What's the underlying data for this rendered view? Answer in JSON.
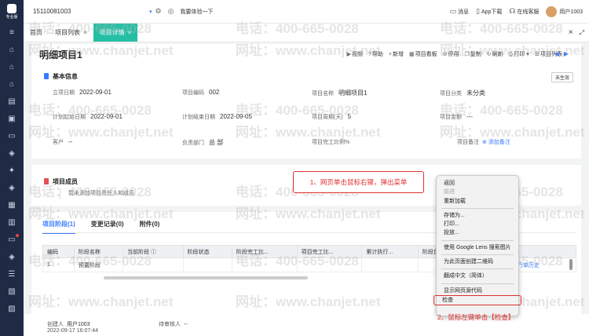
{
  "sidebar": {
    "brand_label": "专业版",
    "icons": [
      "menu-icon",
      "home-icon",
      "home-icon",
      "home-icon",
      "clipboard-icon",
      "gift-icon",
      "document-icon",
      "box-icon",
      "settings-icon",
      "box-icon",
      "briefcase-icon",
      "folder-icon",
      "document-icon",
      "box-icon",
      "list-icon",
      "inbox-icon",
      "layers-icon"
    ]
  },
  "topbar": {
    "company": "15110081003",
    "experience": "我要体验一下",
    "messages": "消息",
    "app_download": "App下载",
    "online_service": "在线客服",
    "user": "用户1003"
  },
  "tabs": [
    {
      "label": "首页",
      "closable": false,
      "active": false
    },
    {
      "label": "项目列表",
      "closable": true,
      "active": false
    },
    {
      "label": "项目详情",
      "closable": true,
      "active": true
    }
  ],
  "page": {
    "title": "明细项目1",
    "actions": [
      "视频",
      "帮助",
      "新增",
      "项目看板",
      "停用",
      "复制",
      "刷新",
      "打印",
      "项目列表"
    ],
    "status_badge": "未生效"
  },
  "basic_info": {
    "section_title": "基本信息",
    "fields": [
      {
        "label": "立项日期",
        "value": "2022-09-01"
      },
      {
        "label": "项目编码",
        "value": "002"
      },
      {
        "label": "项目名称",
        "value": "明细项目1"
      },
      {
        "label": "项目分类",
        "value": "未分类"
      },
      {
        "label": "计划起始日期",
        "value": "2022-09-01"
      },
      {
        "label": "计划结束日期",
        "value": "2022-09-05"
      },
      {
        "label": "项目周期(天)",
        "value": "5"
      },
      {
        "label": "项目金额",
        "value": "---"
      },
      {
        "label": "客户",
        "value": "--"
      },
      {
        "label": "负责部门",
        "value": "总 部"
      },
      {
        "label": "项目完工比例%",
        "value": ""
      },
      {
        "label": "项目备注",
        "value": "添加备注"
      }
    ]
  },
  "members": {
    "section_title": "项目成员",
    "empty_text": "暂未添加项目责任人和成员"
  },
  "sub_tabs": [
    "项目阶段(1)",
    "变更记录(0)",
    "附件(0)"
  ],
  "table": {
    "columns": [
      "编码",
      "阶段名称",
      "当前阶段 ⓘ",
      "阶段状态",
      "阶段完工比...",
      "项目完工比...",
      "累计执行...",
      "阶段负责人",
      "",
      "操作"
    ],
    "rows": [
      [
        "1",
        "预置阶段",
        "",
        "",
        "",
        "",
        "",
        "",
        "",
        "执行单  执行单历史"
      ]
    ]
  },
  "footer": {
    "creator_label": "创建人",
    "creator": "用户1003",
    "created_at": "2022-09-17 16:07:44",
    "reviewer_label": "待审核人",
    "reviewer": "--"
  },
  "context_menu": {
    "items": [
      "返回",
      "前进",
      "重新加载",
      "存储为...",
      "打印...",
      "投放...",
      "使用 Google Lens 搜索图片",
      "为此页面创建二维码",
      "翻成中文（简体）",
      "显示网页源代码",
      "检查"
    ],
    "disabled": [
      "前进"
    ]
  },
  "annotations": {
    "step1": "1、网页单击鼠标右键，弹出菜单",
    "step2": "2、鼠标左键单击【检查】"
  },
  "watermark": {
    "phone": "电话：400-665-0028",
    "site": "网址：www.chanjet.net"
  },
  "colors": {
    "accent": "#26bfa5",
    "link": "#3b7cff",
    "annotation": "#e03030",
    "sidebar": "#1f2b45"
  }
}
